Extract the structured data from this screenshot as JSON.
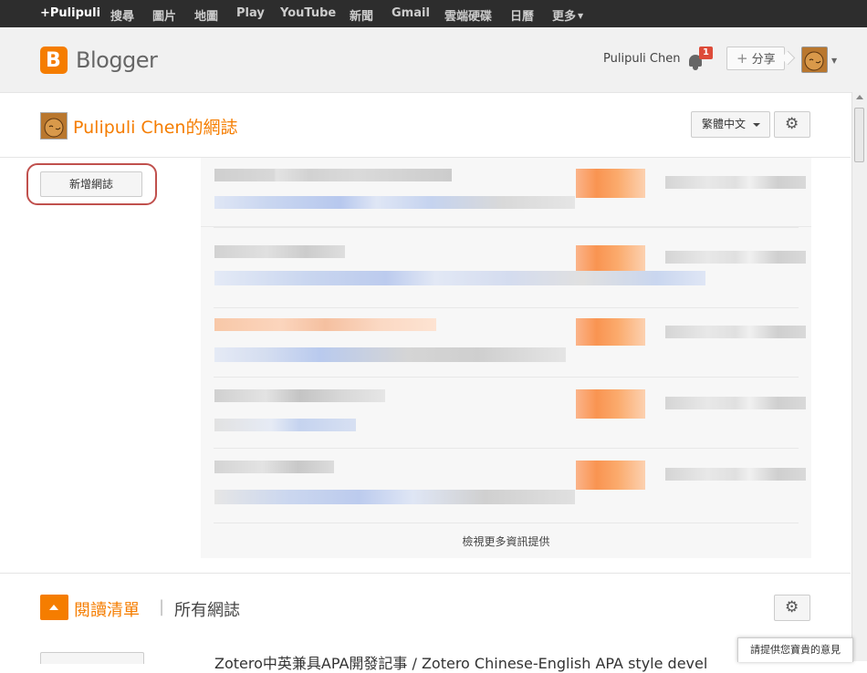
{
  "topbar": {
    "items": [
      "+Pulipuli",
      "搜尋",
      "圖片",
      "地圖",
      "Play",
      "YouTube",
      "新聞",
      "Gmail",
      "雲端硬碟",
      "日曆",
      "更多"
    ]
  },
  "header": {
    "brand": "Blogger",
    "logo_letter": "B",
    "user_name": "Pulipuli Chen",
    "notification_count": "1",
    "share_label": "分享",
    "share_plus": "+"
  },
  "blog": {
    "title": "Pulipuli Chen的網誌",
    "language": "繁體中文",
    "settings_icon": "gear-icon"
  },
  "sidebar": {
    "new_blog_label": "新增網誌"
  },
  "feed": {
    "more_label": "檢視更多資訊提供"
  },
  "reading_list": {
    "title": "閱讀清單",
    "separator": "|",
    "all_blogs": "所有網誌",
    "first_item_text": "Zotero中英兼具APA開發記事 / Zotero Chinese-English APA style devel"
  },
  "feedback": {
    "label": "請提供您寶貴的意見"
  },
  "colors": {
    "brand_orange": "#f57d00",
    "topbar_bg": "#2d2d2d",
    "badge_red": "#dd4b39",
    "highlight_ring": "#c0504d"
  }
}
